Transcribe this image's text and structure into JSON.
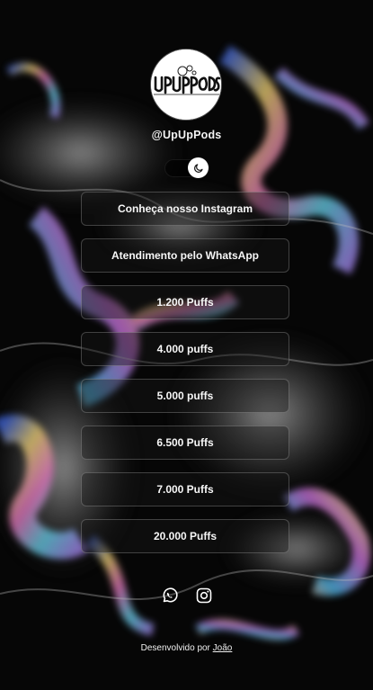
{
  "profile": {
    "avatar_text": "UPUPPODS",
    "handle": "@UpUpPods"
  },
  "theme_toggle": {
    "icon": "moon-icon",
    "state": "dark"
  },
  "links": [
    {
      "label": "Conheça nosso Instagram"
    },
    {
      "label": "Atendimento pelo WhatsApp"
    },
    {
      "label": "1.200 Puffs"
    },
    {
      "label": "4.000 puffs"
    },
    {
      "label": "5.000 puffs"
    },
    {
      "label": "6.500 Puffs"
    },
    {
      "label": "7.000 Puffs"
    },
    {
      "label": "20.000 Puffs"
    }
  ],
  "socials": [
    {
      "icon": "whatsapp-icon"
    },
    {
      "icon": "instagram-icon"
    }
  ],
  "footer": {
    "prefix": "Desenvolvido por",
    "author": "João"
  },
  "colors": {
    "background": "#050505",
    "button_border": "#ffffff",
    "text": "#ffffff"
  }
}
